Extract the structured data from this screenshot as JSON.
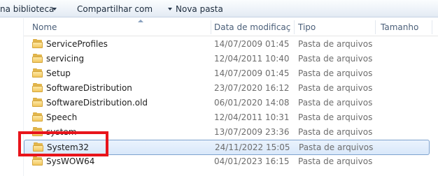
{
  "toolbar": {
    "include_library_label": "na biblioteca",
    "share_label": "Compartilhar com",
    "new_folder_label": "Nova pasta"
  },
  "columns": {
    "name": "Nome",
    "date": "Data de modificaç",
    "type": "Tipo",
    "size": "Tamanho"
  },
  "rows": [
    {
      "name": "ServiceProfiles",
      "date": "14/07/2009 01:45",
      "type": "Pasta de arquivos"
    },
    {
      "name": "servicing",
      "date": "12/04/2011 10:40",
      "type": "Pasta de arquivos"
    },
    {
      "name": "Setup",
      "date": "14/07/2009 01:45",
      "type": "Pasta de arquivos"
    },
    {
      "name": "SoftwareDistribution",
      "date": "23/07/2020 16:12",
      "type": "Pasta de arquivos"
    },
    {
      "name": "SoftwareDistribution.old",
      "date": "06/01/2020 14:08",
      "type": "Pasta de arquivos"
    },
    {
      "name": "Speech",
      "date": "12/04/2011 10:31",
      "type": "Pasta de arquivos"
    },
    {
      "name": "system",
      "date": "13/07/2009 23:36",
      "type": "Pasta de arquivos"
    },
    {
      "name": "System32",
      "date": "24/11/2022 15:05",
      "type": "Pasta de arquivos",
      "selected": true
    },
    {
      "name": "SysWOW64",
      "date": "04/01/2023 16:15",
      "type": "Pasta de arquivos"
    }
  ],
  "colors": {
    "selection_border": "#7da2ce",
    "highlight_annotation": "#e8141b",
    "folder": "#f2c75d"
  }
}
